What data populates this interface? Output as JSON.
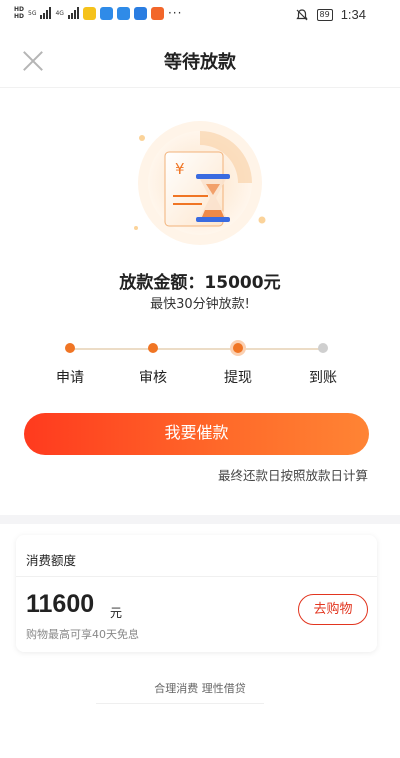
{
  "status_bar": {
    "hd_label": "HD",
    "net_1": "5G",
    "net_2": "4G",
    "more": "···",
    "battery": "89",
    "time": "1:34"
  },
  "header": {
    "title": "等待放款"
  },
  "loan": {
    "amount_text": "放款金额：15000元",
    "eta_text": "最快30分钟放款!"
  },
  "progress": {
    "steps": [
      {
        "label": "申请",
        "state": "done"
      },
      {
        "label": "审核",
        "state": "done"
      },
      {
        "label": "提现",
        "state": "current"
      },
      {
        "label": "到账",
        "state": "todo"
      }
    ]
  },
  "actions": {
    "urge_label": "我要催款",
    "note": "最终还款日按照放款日计算"
  },
  "credit_card": {
    "title": "消费额度",
    "value": "11600",
    "unit": "元",
    "note": "购物最高可享40天免息",
    "shop_label": "去购物"
  },
  "footer": {
    "slogan": "合理消费 理性借贷"
  },
  "colors": {
    "accent": "#f07524",
    "button_start": "#ff3a1e",
    "button_end": "#ff8434",
    "shop_red": "#e2351f"
  }
}
